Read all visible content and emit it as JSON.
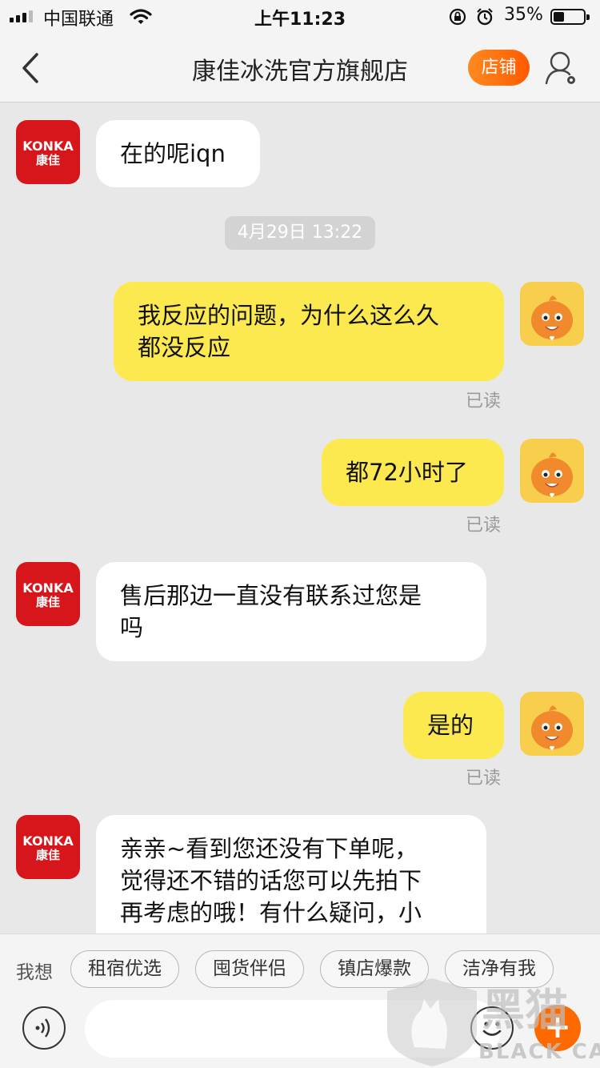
{
  "status_bar": {
    "carrier": "中国联通",
    "time": "上午11:23",
    "battery_pct": "35%",
    "battery_level": 0.35
  },
  "nav": {
    "title": "康佳冰洗官方旗舰店",
    "shop_label": "店铺"
  },
  "brand": {
    "logo_en": "KONKA",
    "logo_cn": "康佳"
  },
  "messages": [
    {
      "side": "left",
      "text_lines": [
        "在的呢iqn"
      ]
    },
    {
      "side": "right",
      "text_lines": [
        "我反应的问题，为什么这么久",
        "都没反应"
      ],
      "read": "已读"
    },
    {
      "side": "right",
      "text_lines": [
        "都72小时了"
      ],
      "read": "已读"
    },
    {
      "side": "left",
      "text_lines": [
        "售后那边一直没有联系过您是",
        "吗"
      ]
    },
    {
      "side": "right",
      "text_lines": [
        "是的"
      ],
      "read": "已读"
    },
    {
      "side": "left",
      "text_lines": [
        "亲亲~看到您还没有下单呢，",
        "觉得还不错的话您可以先拍下",
        "再考虑的哦！有什么疑问，小"
      ]
    }
  ],
  "timestamp": "4月29日 13:22",
  "bottom": {
    "want_label": "我想",
    "chips": [
      "租宿优选",
      "囤货伴侣",
      "镇店爆款",
      "洁净有我"
    ],
    "input_placeholder": ""
  },
  "watermark": {
    "text_cn": "黑猫",
    "text_en": "BLACK CAT"
  },
  "colors": {
    "accent": "#ff6a00",
    "user_bubble": "#fce94f",
    "brand_red": "#d7161b",
    "background": "#e8e8e8"
  }
}
